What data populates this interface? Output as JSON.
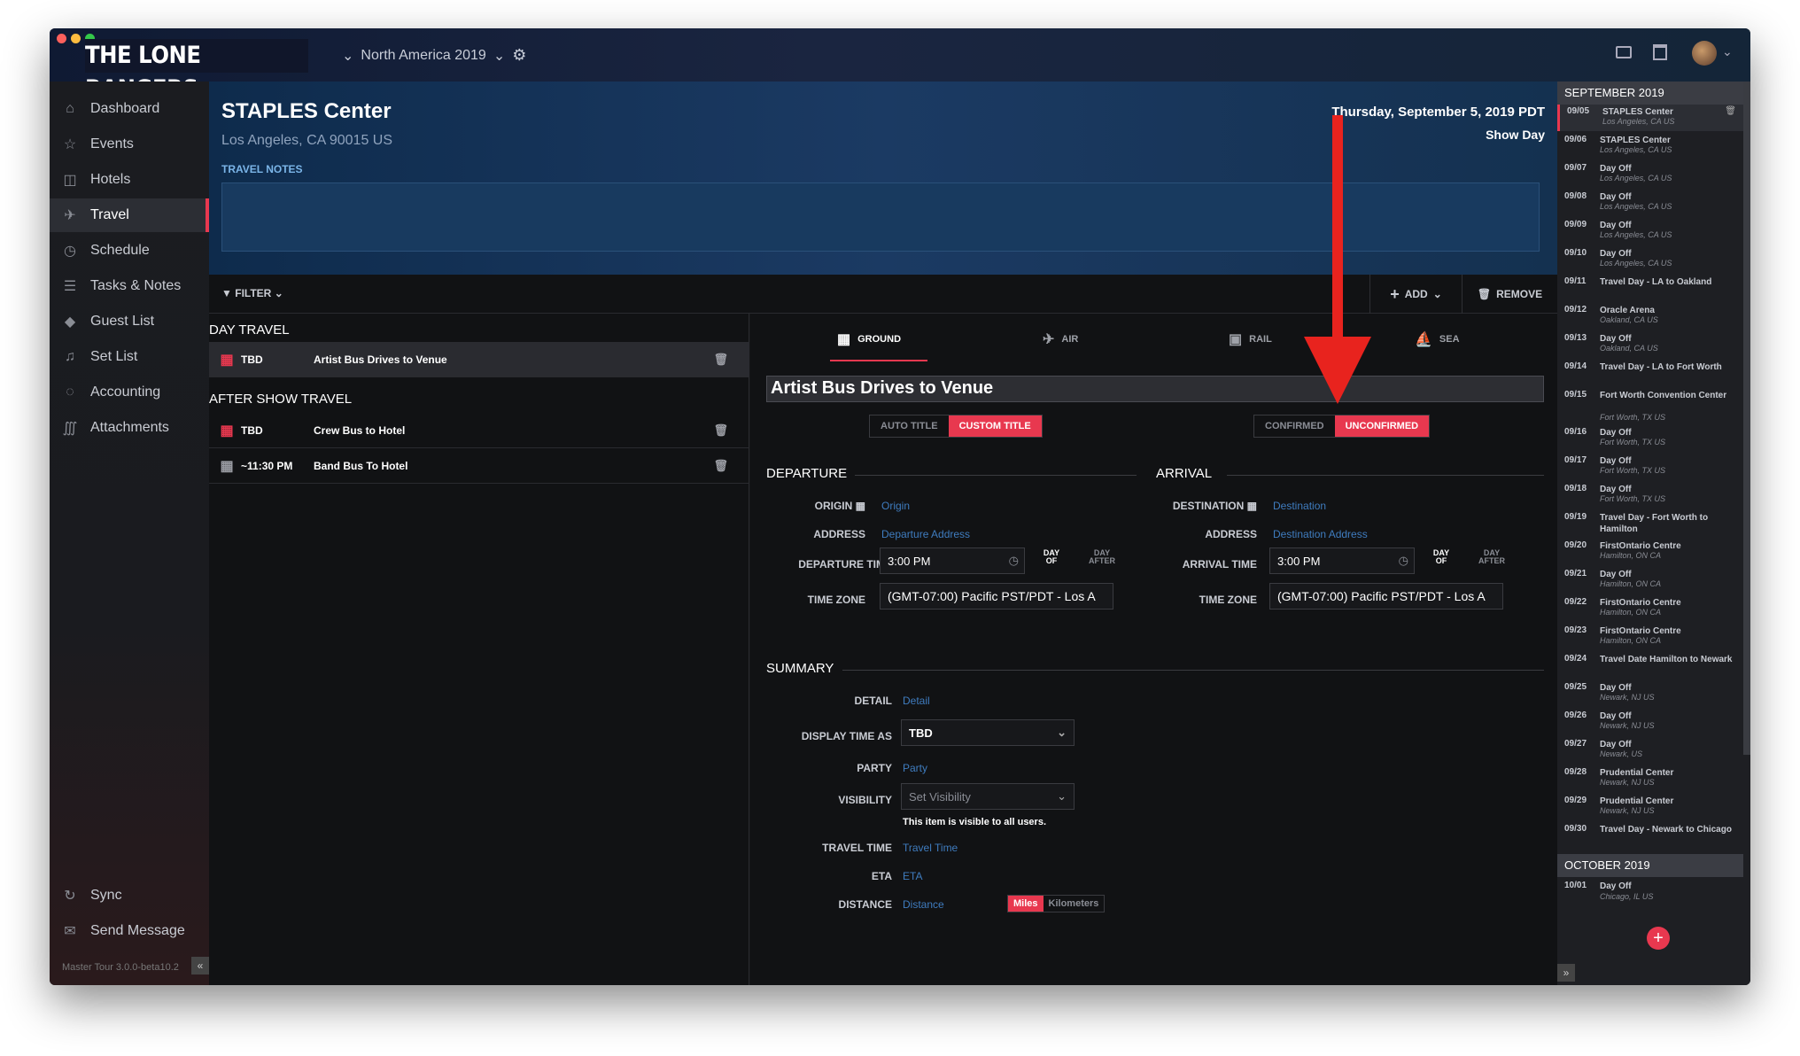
{
  "app": {
    "logo": "THE LONE RANGERS",
    "tour": "North America 2019"
  },
  "sidebar": {
    "items": [
      {
        "label": "Dashboard",
        "icon": "home-icon"
      },
      {
        "label": "Events",
        "icon": "star-icon"
      },
      {
        "label": "Hotels",
        "icon": "hotel-icon"
      },
      {
        "label": "Travel",
        "icon": "plane-icon"
      },
      {
        "label": "Schedule",
        "icon": "clock-icon"
      },
      {
        "label": "Tasks & Notes",
        "icon": "list-icon"
      },
      {
        "label": "Guest List",
        "icon": "tag-icon"
      },
      {
        "label": "Set List",
        "icon": "music-icon"
      },
      {
        "label": "Accounting",
        "icon": "money-icon"
      },
      {
        "label": "Attachments",
        "icon": "paperclip-icon"
      }
    ],
    "sync": "Sync",
    "send": "Send Message",
    "version": "Master Tour 3.0.0-beta10.2"
  },
  "header": {
    "venue": "STAPLES Center",
    "address": "Los Angeles, CA 90015 US",
    "notes_label": "TRAVEL NOTES",
    "date": "Thursday, September 5, 2019 PDT",
    "day_type": "Show Day"
  },
  "toolbar": {
    "filter": "FILTER",
    "add": "ADD",
    "remove": "REMOVE"
  },
  "list": {
    "day_travel": "DAY TRAVEL",
    "after_show": "AFTER SHOW TRAVEL",
    "rows": [
      {
        "time": "TBD",
        "name": "Artist Bus Drives to Venue"
      },
      {
        "time": "TBD",
        "name": "Crew Bus to Hotel"
      },
      {
        "time": "~11:30 PM",
        "name": "Band Bus To Hotel"
      }
    ]
  },
  "detail": {
    "tabs": [
      "GROUND",
      "AIR",
      "RAIL",
      "SEA"
    ],
    "title": "Artist Bus Drives to Venue",
    "title_mode": [
      "AUTO TITLE",
      "CUSTOM TITLE"
    ],
    "confirm": [
      "CONFIRMED",
      "UNCONFIRMED"
    ],
    "departure": {
      "heading": "DEPARTURE",
      "origin_label": "ORIGIN",
      "origin_ph": "Origin",
      "address_label": "ADDRESS",
      "address_ph": "Departure Address",
      "time_label": "DEPARTURE TIME",
      "time": "3:00 PM",
      "tz_label": "TIME ZONE",
      "tz": "(GMT-07:00) Pacific PST/PDT - Los A"
    },
    "arrival": {
      "heading": "ARRIVAL",
      "dest_label": "DESTINATION",
      "dest_ph": "Destination",
      "address_label": "ADDRESS",
      "address_ph": "Destination Address",
      "time_label": "ARRIVAL TIME",
      "time": "3:00 PM",
      "tz_label": "TIME ZONE",
      "tz": "(GMT-07:00) Pacific PST/PDT - Los A"
    },
    "day_of": "DAY OF",
    "day_after": "DAY AFTER",
    "summary": {
      "heading": "SUMMARY",
      "detail_label": "DETAIL",
      "detail_ph": "Detail",
      "display_label": "DISPLAY TIME AS",
      "display": "TBD",
      "party_label": "PARTY",
      "party_ph": "Party",
      "vis_label": "VISIBILITY",
      "vis_ph": "Set Visibility",
      "vis_note": "This item is visible to all users.",
      "tt_label": "TRAVEL TIME",
      "tt_ph": "Travel Time",
      "eta_label": "ETA",
      "eta_ph": "ETA",
      "dist_label": "DISTANCE",
      "dist_ph": "Distance",
      "units": [
        "Miles",
        "Kilometers"
      ]
    }
  },
  "calendar": {
    "month1": "SEPTEMBER 2019",
    "events": [
      {
        "d": "09/05",
        "n": "STAPLES Center",
        "l": "Los Angeles, CA US"
      },
      {
        "d": "09/06",
        "n": "STAPLES Center",
        "l": "Los Angeles, CA US"
      },
      {
        "d": "09/07",
        "n": "Day Off",
        "l": "Los Angeles, CA US"
      },
      {
        "d": "09/08",
        "n": "Day Off",
        "l": "Los Angeles, CA US"
      },
      {
        "d": "09/09",
        "n": "Day Off",
        "l": "Los Angeles, CA US"
      },
      {
        "d": "09/10",
        "n": "Day Off",
        "l": "Los Angeles, CA US"
      },
      {
        "d": "09/11",
        "n": "Travel Day - LA to Oakland",
        "l": ""
      },
      {
        "d": "09/12",
        "n": "Oracle Arena",
        "l": "Oakland, CA US"
      },
      {
        "d": "09/13",
        "n": "Day Off",
        "l": "Oakland, CA US"
      },
      {
        "d": "09/14",
        "n": "Travel Day - LA to Fort Worth",
        "l": ""
      },
      {
        "d": "09/15",
        "n": "Fort Worth Convention Center",
        "l": "Fort Worth, TX US"
      },
      {
        "d": "09/16",
        "n": "Day Off",
        "l": "Fort Worth, TX US"
      },
      {
        "d": "09/17",
        "n": "Day Off",
        "l": "Fort Worth, TX US"
      },
      {
        "d": "09/18",
        "n": "Day Off",
        "l": "Fort Worth, TX US"
      },
      {
        "d": "09/19",
        "n": "Travel Day - Fort Worth to Hamilton",
        "l": ""
      },
      {
        "d": "09/20",
        "n": "FirstOntario Centre",
        "l": "Hamilton, ON CA"
      },
      {
        "d": "09/21",
        "n": "Day Off",
        "l": "Hamilton, ON CA"
      },
      {
        "d": "09/22",
        "n": "FirstOntario Centre",
        "l": "Hamilton, ON CA"
      },
      {
        "d": "09/23",
        "n": "FirstOntario Centre",
        "l": "Hamilton, ON CA"
      },
      {
        "d": "09/24",
        "n": "Travel Date Hamilton to Newark",
        "l": ""
      },
      {
        "d": "09/25",
        "n": "Day Off",
        "l": "Newark, NJ US"
      },
      {
        "d": "09/26",
        "n": "Day Off",
        "l": "Newark, NJ US"
      },
      {
        "d": "09/27",
        "n": "Day Off",
        "l": "Newark, US"
      },
      {
        "d": "09/28",
        "n": "Prudential Center",
        "l": "Newark, NJ US"
      },
      {
        "d": "09/29",
        "n": "Prudential Center",
        "l": "Newark, NJ US"
      },
      {
        "d": "09/30",
        "n": "Travel Day - Newark to Chicago",
        "l": ""
      }
    ],
    "month2": "OCTOBER 2019",
    "oct": [
      {
        "d": "10/01",
        "n": "Day Off",
        "l": "Chicago, IL US"
      }
    ]
  },
  "colors": {
    "accent": "#e8384f",
    "link": "#3f7cbf"
  }
}
